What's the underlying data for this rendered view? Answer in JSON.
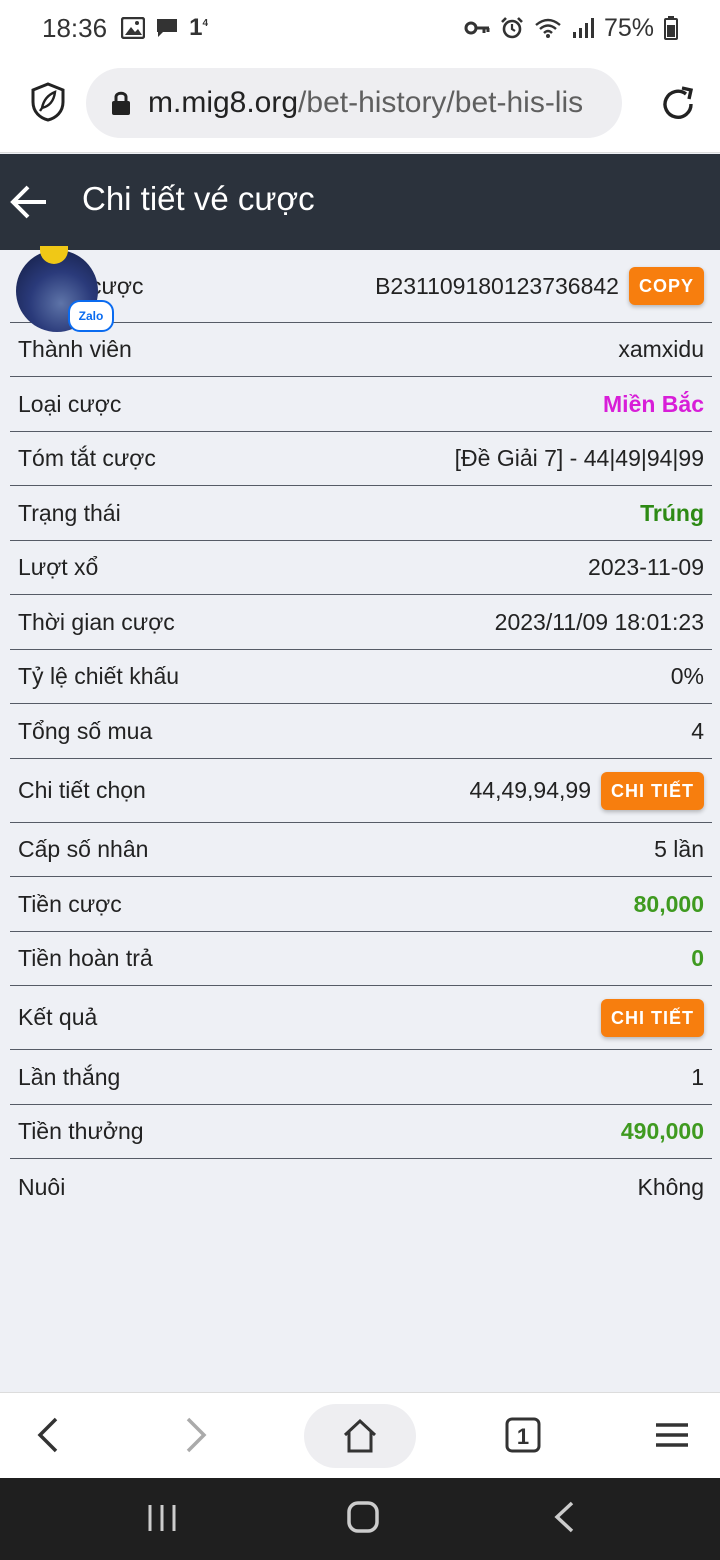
{
  "status_bar": {
    "time": "18:36",
    "notification_count": "1",
    "notification_sub": "4",
    "battery": "75%"
  },
  "browser": {
    "url_host": "m.mig8.org",
    "url_path": "/bet-history/bet-his-lis"
  },
  "header": {
    "title": "Chi tiết vé cược"
  },
  "rows": [
    {
      "label": "Mã cược",
      "visible_label": "cược",
      "value": "B231109180123736842",
      "button": "COPY"
    },
    {
      "label": "Thành viên",
      "value": "xamxidu"
    },
    {
      "label": "Loại cược",
      "value": "Miền Bắc",
      "color": "#d81ed8"
    },
    {
      "label": "Tóm tắt cược",
      "value": "[Đề Giải 7] - 44|49|94|99"
    },
    {
      "label": "Trạng thái",
      "value": "Trúng",
      "color": "#2d8a14"
    },
    {
      "label": "Lượt xổ",
      "value": "2023-11-09"
    },
    {
      "label": "Thời gian cược",
      "value": "2023/11/09 18:01:23"
    },
    {
      "label": "Tỷ lệ chiết khấu",
      "value": "0%"
    },
    {
      "label": "Tổng số mua",
      "value": "4"
    },
    {
      "label": "Chi tiết chọn",
      "value": "44,49,94,99",
      "button": "CHI TIẾT"
    },
    {
      "label": "Cấp số nhân",
      "value": "5 lần"
    },
    {
      "label": "Tiền cược",
      "value": "80,000",
      "color": "#3f9a20"
    },
    {
      "label": "Tiền hoàn trả",
      "value": "0",
      "color": "#3f9a20"
    },
    {
      "label": "Kết quả",
      "value": "",
      "button": "CHI TIẾT"
    },
    {
      "label": "Lần thắng",
      "value": "1"
    },
    {
      "label": "Tiền thưởng",
      "value": "490,000",
      "color": "#3f9a20"
    },
    {
      "label": "Nuôi",
      "value": "Không"
    }
  ],
  "overlay": {
    "zalo_label": "Zalo"
  }
}
